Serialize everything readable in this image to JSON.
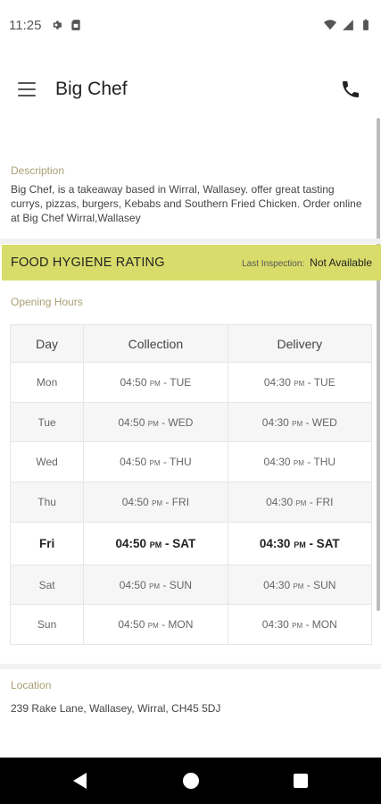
{
  "status_bar": {
    "time": "11:25",
    "icons": [
      "gear-icon",
      "sim-card-icon",
      "wifi-icon",
      "signal-icon",
      "battery-icon"
    ]
  },
  "app_bar": {
    "title": "Big Chef"
  },
  "description": {
    "label": "Description",
    "text": "Big Chef, is a takeaway based in Wirral, Wallasey. offer great tasting currys, pizzas, burgers, Kebabs and Southern Fried Chicken. Order online at Big Chef Wirral,Wallasey"
  },
  "hygiene": {
    "title": "FOOD HYGIENE RATING",
    "inspection_label": "Last Inspection:",
    "inspection_value": "Not Available",
    "color": "#d8dc6a"
  },
  "opening_hours": {
    "label": "Opening Hours",
    "headers": [
      "Day",
      "Collection",
      "Delivery"
    ],
    "rows": [
      {
        "day": "Mon",
        "col_time": "04:50",
        "col_ampm": "PM",
        "col_end": " - TUE",
        "del_time": "04:30",
        "del_ampm": "PM",
        "del_end": " - TUE"
      },
      {
        "day": "Tue",
        "col_time": "04:50",
        "col_ampm": "PM",
        "col_end": " - WED",
        "del_time": "04:30",
        "del_ampm": "PM",
        "del_end": " - WED"
      },
      {
        "day": "Wed",
        "col_time": "04:50",
        "col_ampm": "PM",
        "col_end": " - THU",
        "del_time": "04:30",
        "del_ampm": "PM",
        "del_end": " - THU"
      },
      {
        "day": "Thu",
        "col_time": "04:50",
        "col_ampm": "PM",
        "col_end": " - FRI",
        "del_time": "04:30",
        "del_ampm": "PM",
        "del_end": " - FRI"
      },
      {
        "day": "Fri",
        "col_time": "04:50",
        "col_ampm": "PM",
        "col_end": " - SAT",
        "del_time": "04:30",
        "del_ampm": "PM",
        "del_end": " - SAT"
      },
      {
        "day": "Sat",
        "col_time": "04:50",
        "col_ampm": "PM",
        "col_end": " - SUN",
        "del_time": "04:30",
        "del_ampm": "PM",
        "del_end": " - SUN"
      },
      {
        "day": "Sun",
        "col_time": "04:50",
        "col_ampm": "PM",
        "col_end": " - MON",
        "del_time": "04:30",
        "del_ampm": "PM",
        "del_end": " - MON"
      }
    ],
    "today": "Fri"
  },
  "location": {
    "label": "Location",
    "address": "239 Rake Lane, Wallasey, Wirral, CH45 5DJ"
  },
  "nav_bar": {
    "icons": [
      "back-icon",
      "home-icon",
      "recents-icon"
    ]
  }
}
